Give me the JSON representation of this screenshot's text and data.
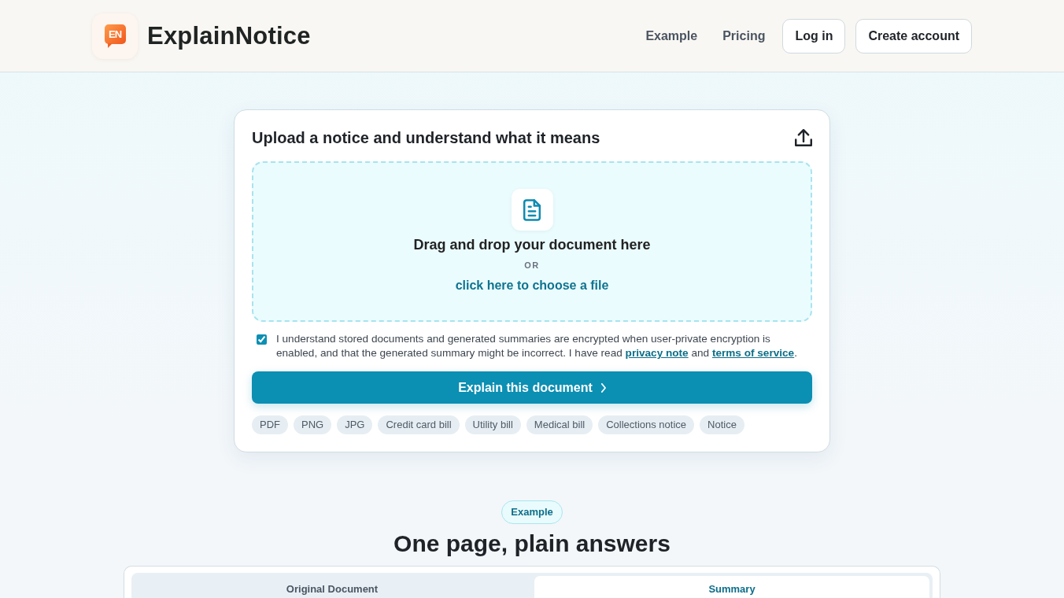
{
  "header": {
    "logo_mark": "EN",
    "brand": "ExplainNotice",
    "nav": [
      {
        "kind": "link",
        "label": "Example"
      },
      {
        "kind": "link",
        "label": "Pricing"
      },
      {
        "kind": "button",
        "label": "Log in"
      },
      {
        "kind": "button",
        "label": "Create account"
      }
    ]
  },
  "upload_card": {
    "title": "Upload a notice and understand what it means",
    "drop_zone": {
      "heading": "Drag and drop your document here",
      "separator": "OR",
      "link": "click here to choose a file"
    },
    "consent": {
      "checked": true,
      "parts": [
        {
          "kind": "text",
          "text": "I understand stored documents and generated summaries are encrypted when user-private encryption is enabled, and that the generated summary might be incorrect. I have read "
        },
        {
          "kind": "link",
          "text": "privacy note"
        },
        {
          "kind": "text",
          "text": " and "
        },
        {
          "kind": "link",
          "text": "terms of service"
        },
        {
          "kind": "text",
          "text": "."
        }
      ]
    },
    "submit_button": "Explain this document",
    "file_types": [
      "PDF",
      "PNG",
      "JPG",
      "Credit card bill",
      "Utility bill",
      "Medical bill",
      "Collections notice",
      "Notice"
    ]
  },
  "example_section": {
    "badge": "Example",
    "title": "One page, plain answers",
    "tabs": [
      {
        "label": "Original Document",
        "selected": false
      },
      {
        "label": "Summary",
        "selected": true
      }
    ]
  }
}
